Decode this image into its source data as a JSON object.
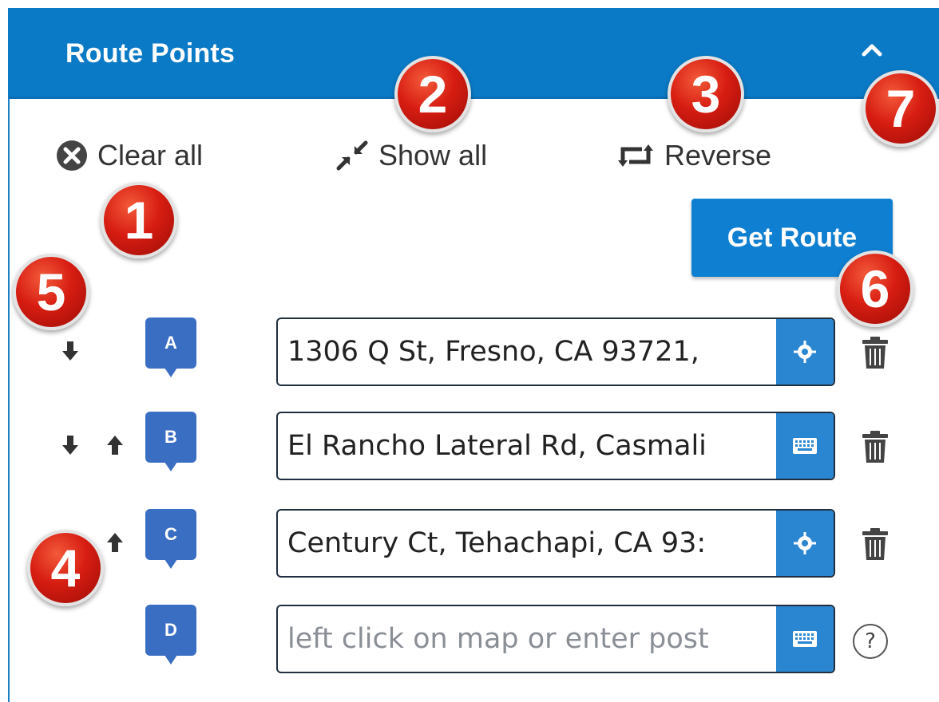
{
  "panel": {
    "title": "Route Points",
    "accent_color": "#0a7ac6",
    "collapse_icon": "chevron-up-icon"
  },
  "toolbar": {
    "clear_all": "Clear all",
    "show_all": "Show all",
    "reverse": "Reverse",
    "get_route": "Get Route"
  },
  "route_points": [
    {
      "label": "A",
      "value": "1306 Q St, Fresno, CA 93721,",
      "placeholder": "",
      "field_icon": "locate-icon",
      "action_icon": "trash-icon",
      "down": true,
      "up": false
    },
    {
      "label": "B",
      "value": "El Rancho Lateral Rd, Casmali",
      "placeholder": "",
      "field_icon": "keyboard-icon",
      "action_icon": "trash-icon",
      "down": true,
      "up": true
    },
    {
      "label": "C",
      "value": "Century Ct, Tehachapi, CA 93:",
      "placeholder": "",
      "field_icon": "locate-icon",
      "action_icon": "trash-icon",
      "down": false,
      "up": true
    },
    {
      "label": "D",
      "value": "",
      "placeholder": "left click on map or enter post",
      "field_icon": "keyboard-icon",
      "action_icon": "help-icon",
      "down": false,
      "up": false
    }
  ],
  "help_symbol": "?",
  "callouts": [
    "1",
    "2",
    "3",
    "4",
    "5",
    "6",
    "7"
  ]
}
